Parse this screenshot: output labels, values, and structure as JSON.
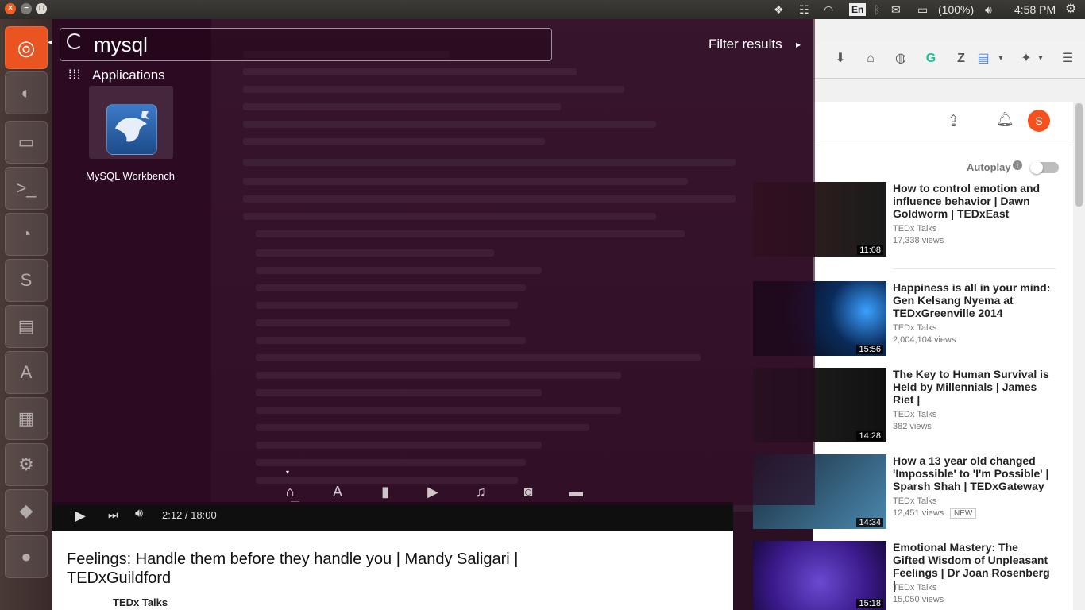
{
  "panel": {
    "close_glyph": "×",
    "min_glyph": "−",
    "max_glyph": "□",
    "keyboard": "En",
    "battery": "(100%)",
    "clock": "4:58 PM"
  },
  "dash": {
    "search_value": "mysql",
    "filter_label": "Filter results",
    "category_label": "Applications",
    "results": [
      {
        "label": "MySQL Workbench",
        "icon": "mysql-workbench-icon"
      }
    ],
    "lenses": [
      "home-lens-icon",
      "applications-lens-icon",
      "files-lens-icon",
      "video-lens-icon",
      "music-lens-icon",
      "photo-lens-icon",
      "social-lens-icon"
    ]
  },
  "terminal": {
    "prompt_tilde": "~"
  },
  "player": {
    "time": "2:12 / 18:00"
  },
  "main_video": {
    "title": "Feelings: Handle them before they handle you | Mandy Saligari | TEDxGuildford",
    "channel": "TEDx Talks"
  },
  "youtube": {
    "avatar_letter": "S",
    "autoplay_label": "Autoplay",
    "suggestions": [
      {
        "title": "How to control emotion and influence behavior | Dawn Goldworm | TEDxEast",
        "channel": "TEDx Talks",
        "views": "17,338 views",
        "duration": "11:08",
        "badge": ""
      },
      {
        "title": "Happiness is all in your mind: Gen Kelsang Nyema at TEDxGreenville 2014",
        "channel": "TEDx Talks",
        "views": "2,004,104 views",
        "duration": "15:56",
        "badge": ""
      },
      {
        "title": "The Key to Human Survival is Held by Millennials | James Riet |",
        "channel": "TEDx Talks",
        "views": "382 views",
        "duration": "14:28",
        "badge": ""
      },
      {
        "title": "How a 13 year old changed 'Impossible' to 'I'm Possible' | Sparsh Shah | TEDxGateway",
        "channel": "TEDx Talks",
        "views": "12,451 views",
        "duration": "14:34",
        "badge": "NEW"
      },
      {
        "title": "Emotional Mastery: The Gifted Wisdom of Unpleasant Feelings | Dr Joan Rosenberg |",
        "channel": "TEDx Talks",
        "views": "15,050 views",
        "duration": "15:18",
        "badge": ""
      }
    ]
  },
  "colors": {
    "accent_orange": "#e95420",
    "youtube_avatar": "#f4511e"
  }
}
